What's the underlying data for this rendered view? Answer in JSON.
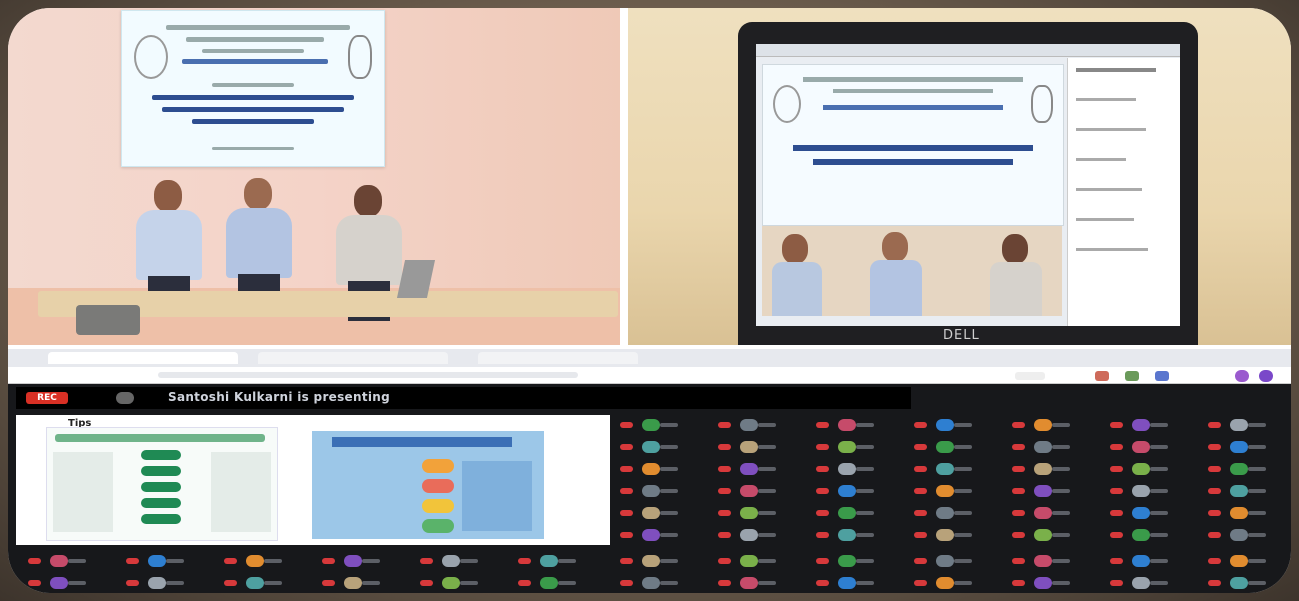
{
  "photos": {
    "left_banner_lines": 8,
    "laptop_brand": "DELL"
  },
  "meeting": {
    "rec_label": "REC",
    "presenting_text": "Santoshi Kulkarni is presenting",
    "slide_heading": "Tips"
  },
  "colors": {
    "rec_red": "#d93025",
    "meet_bg": "#17181b",
    "wall": "#f3d9cf",
    "poster_blue": "#9cc7e8"
  }
}
